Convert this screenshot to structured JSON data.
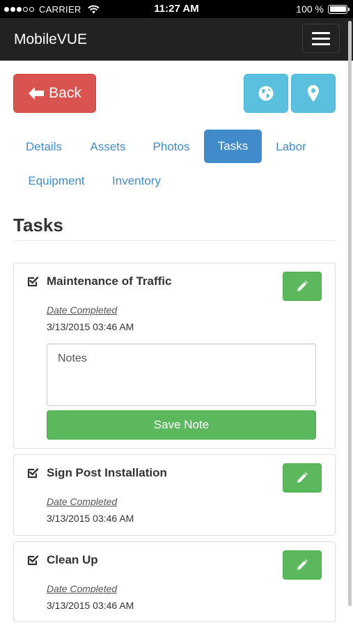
{
  "status_bar": {
    "carrier": "CARRIER",
    "time": "11:27 AM",
    "battery": "100 %",
    "signal_level": 3,
    "signal_max": 5
  },
  "navbar": {
    "brand": "MobileVUE",
    "menu_icon": "hamburger-icon"
  },
  "actions": {
    "back_label": "Back",
    "back_icon": "arrow-left-icon",
    "globe_icon": "globe-icon",
    "location_icon": "map-marker-icon"
  },
  "tabs": [
    {
      "label": "Details",
      "active": false
    },
    {
      "label": "Assets",
      "active": false
    },
    {
      "label": "Photos",
      "active": false
    },
    {
      "label": "Tasks",
      "active": true
    },
    {
      "label": "Labor",
      "active": false
    },
    {
      "label": "Equipment",
      "active": false
    },
    {
      "label": "Inventory",
      "active": false
    }
  ],
  "section": {
    "title": "Tasks"
  },
  "tasks": [
    {
      "title": "Maintenance of Traffic",
      "date_label": "Date Completed",
      "date_value": "3/13/2015 03:46 AM",
      "notes_placeholder": "Notes",
      "save_label": "Save Note"
    },
    {
      "title": "Sign Post Installation",
      "date_label": "Date Completed",
      "date_value": "3/13/2015 03:46 AM"
    },
    {
      "title": "Clean Up",
      "date_label": "Date Completed",
      "date_value": "3/13/2015 03:46 AM"
    }
  ],
  "colors": {
    "navbar": "#222222",
    "back_button": "#d9534f",
    "info_button": "#5bc0de",
    "primary": "#428bca",
    "success": "#5cb85c"
  }
}
